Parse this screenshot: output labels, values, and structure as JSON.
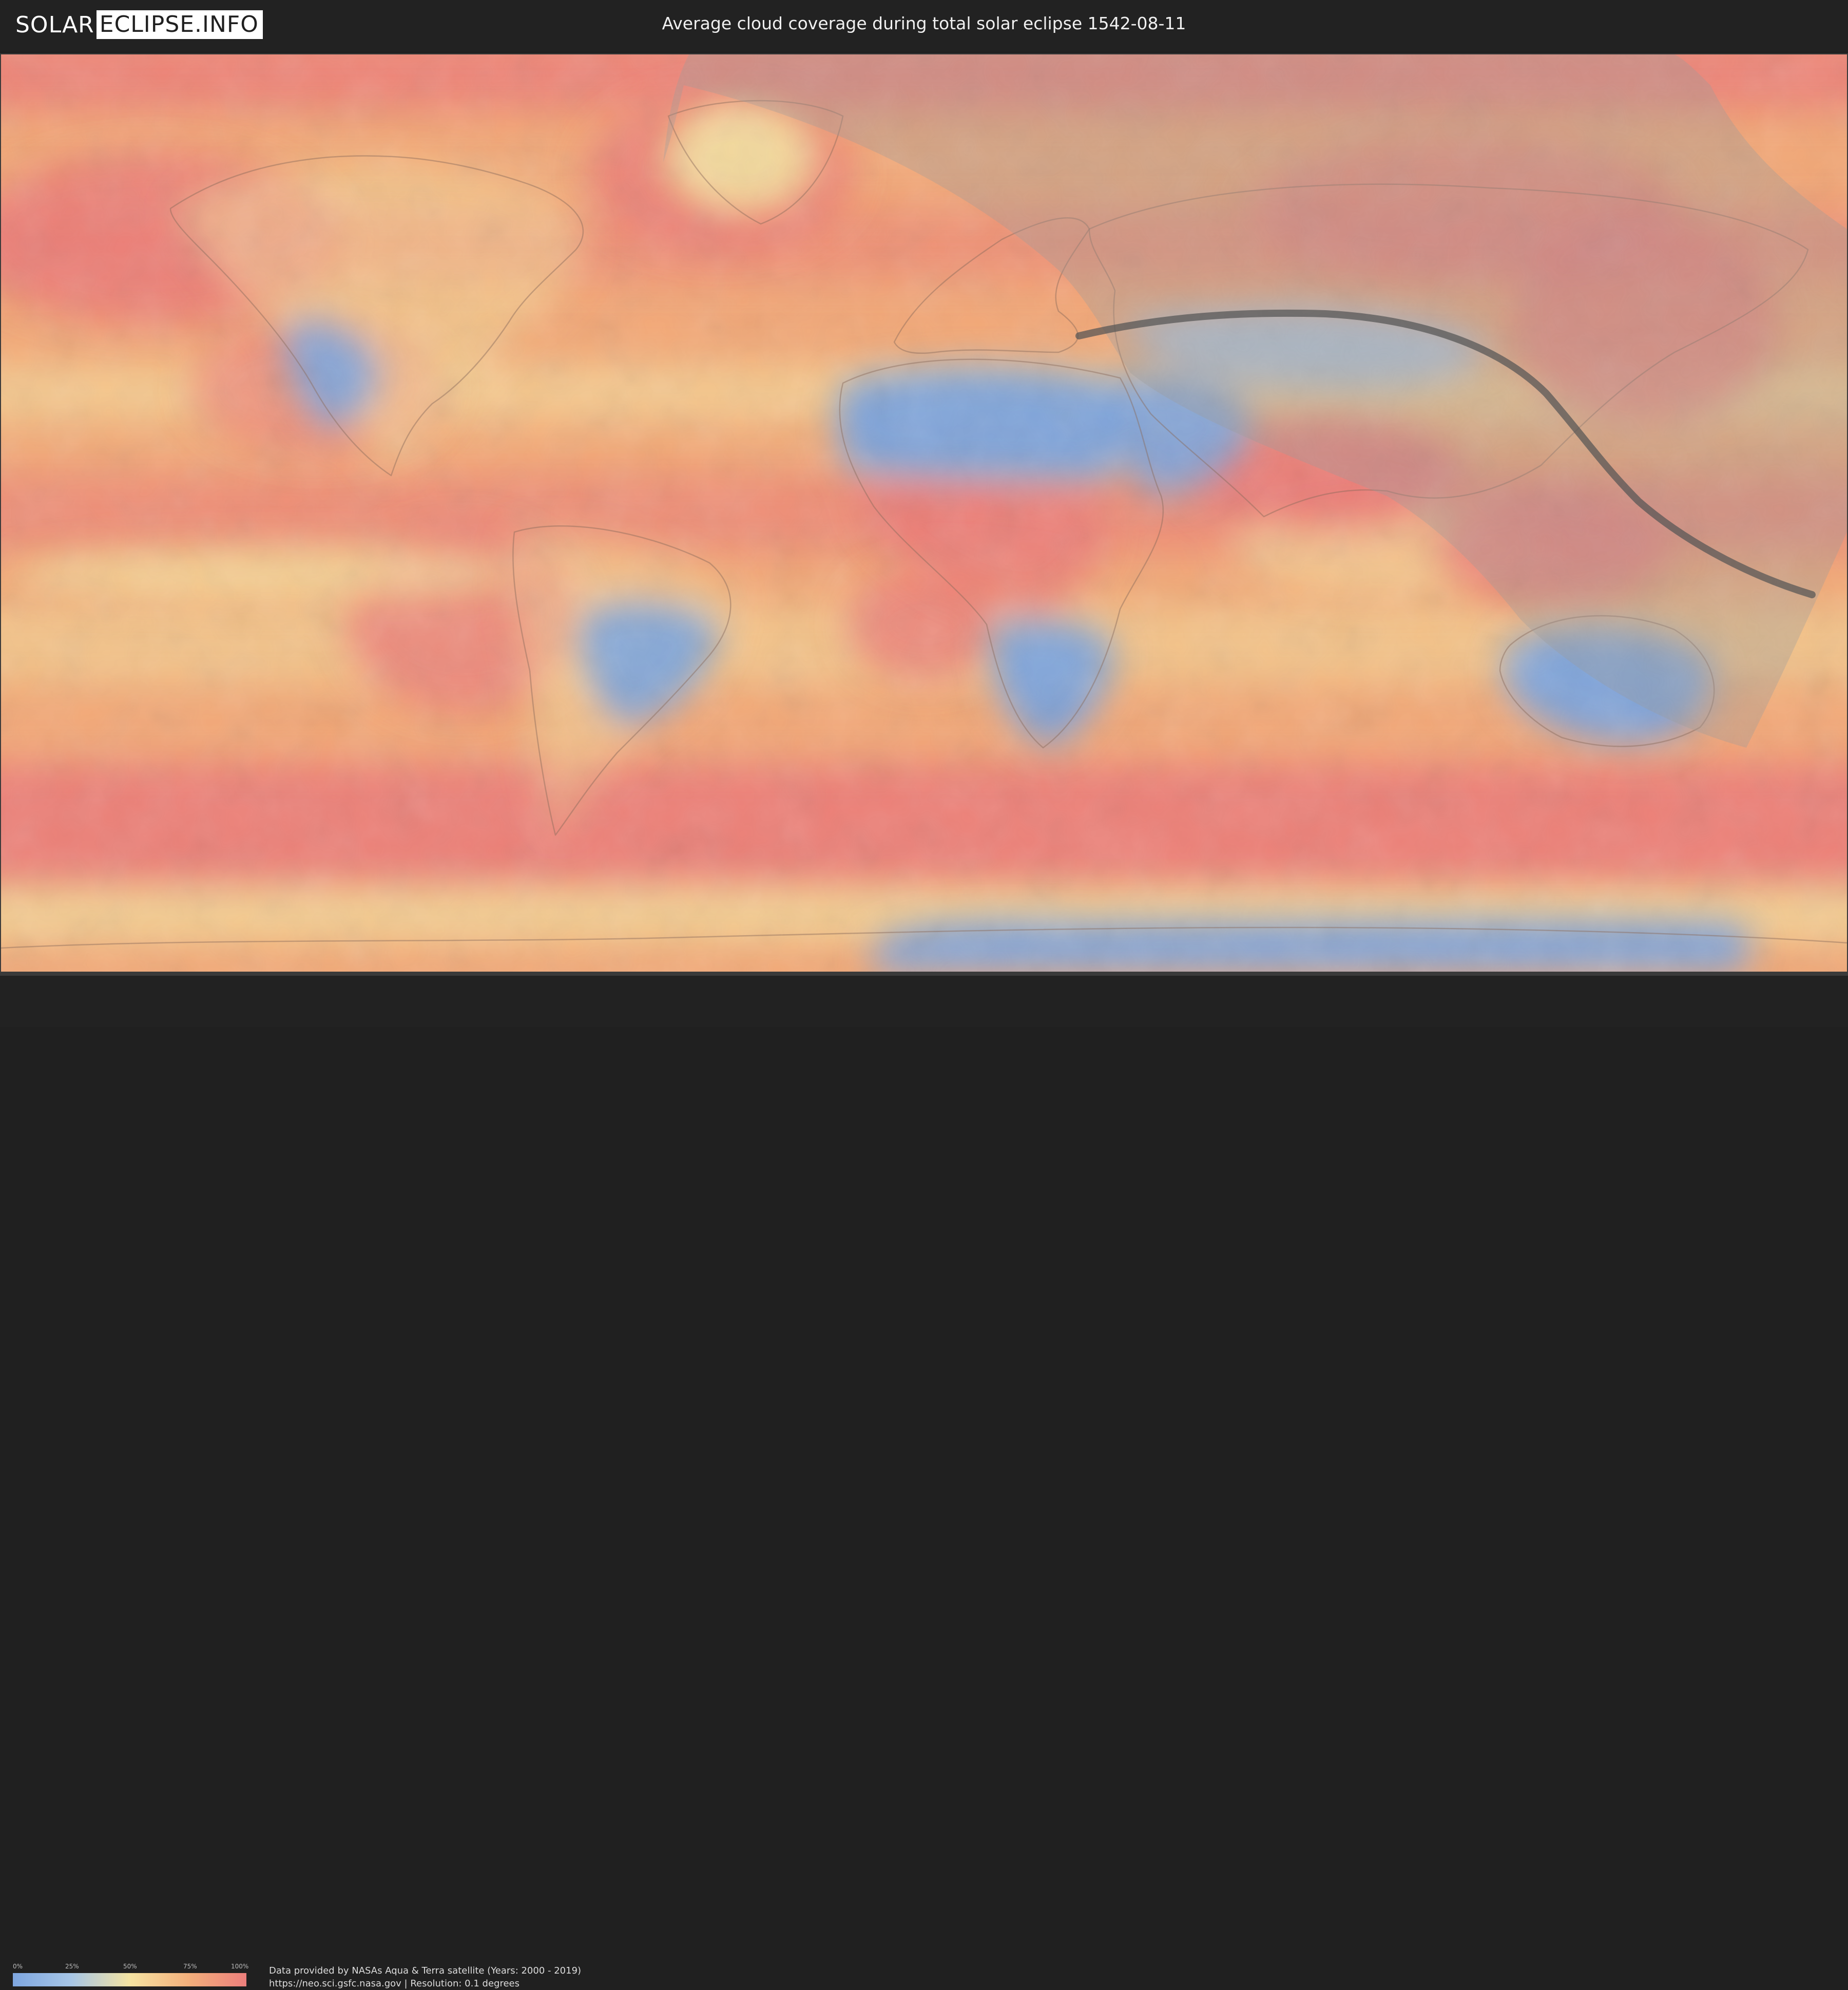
{
  "header": {
    "logo_part1": "SOLAR",
    "logo_part2": "ECLIPSE.INFO",
    "title": "Average cloud coverage during total solar eclipse 1542-08-11"
  },
  "map": {
    "palette": {
      "clear": "#7aa3de",
      "light": "#a9c6e4",
      "medium": "#f5e2a0",
      "heavy": "#f3a877",
      "overcast": "#eb7a78",
      "ice_edge": "#5b86d8"
    },
    "overlay_colors": {
      "visibility_zone": "#9a9a9a",
      "central_path": "#555555"
    }
  },
  "legend": {
    "ticks": [
      "0%",
      "25%",
      "50%",
      "75%",
      "100%"
    ],
    "gradient_colors": [
      "#7ea6e0",
      "#a7c6e6",
      "#f4e3a2",
      "#f3b07c",
      "#ec7f7c"
    ]
  },
  "footer": {
    "credit_line1": "Data provided by NASAs Aqua & Terra satellite (Years: 2000 - 2019)",
    "credit_line2": "https://neo.sci.gsfc.nasa.gov | Resolution: 0.1 degrees"
  }
}
